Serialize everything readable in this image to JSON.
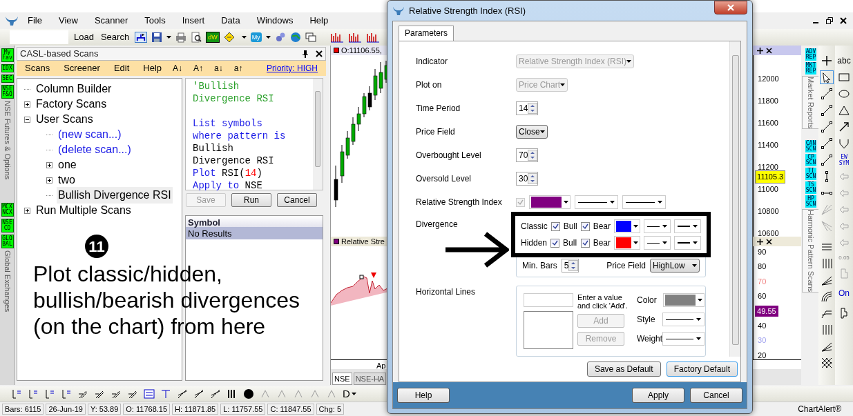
{
  "app": {
    "menu": [
      "File",
      "View",
      "Scanner",
      "Tools",
      "Insert",
      "Data",
      "Windows",
      "Help"
    ]
  },
  "toolbar": {
    "buttons": [
      "Load",
      "Search"
    ],
    "badges": [
      "dW",
      "My"
    ]
  },
  "exchange_strip": [
    {
      "badges": [
        "My Fav",
        "IDX",
        "SEC",
        "NSE F&O"
      ],
      "label": "NSE Futures & Options"
    },
    {
      "badges": [
        "MCX NCX",
        "NSE CD",
        "GLO BAL"
      ],
      "label": "Global Exchanges"
    }
  ],
  "scans_panel": {
    "title": "CASL-based Scans",
    "menu": [
      "Scans",
      "Screener",
      "Edit",
      "Help"
    ],
    "case_buttons": [
      "A↓",
      "A↑",
      "a↓",
      "a↑"
    ],
    "priority": "Priority: HIGH",
    "tree": [
      {
        "label": "Column Builder",
        "kind": "item",
        "selected": false
      },
      {
        "label": "Factory Scans",
        "kind": "folder",
        "expanded": false,
        "selected": false
      },
      {
        "label": "User Scans",
        "kind": "folder",
        "expanded": true,
        "selected": false,
        "children": [
          {
            "label": "(new scan...)",
            "kind": "action",
            "selected": false
          },
          {
            "label": "(delete scan...)",
            "kind": "action",
            "selected": false
          },
          {
            "label": "one",
            "kind": "folder",
            "expanded": false,
            "selected": false
          },
          {
            "label": "two",
            "kind": "folder",
            "expanded": false,
            "selected": false
          },
          {
            "label": "Bullish Divergence RSI",
            "kind": "item",
            "selected": true
          }
        ]
      },
      {
        "label": "Run Multiple Scans",
        "kind": "folder",
        "expanded": false,
        "selected": false
      }
    ],
    "code": [
      {
        "kind": "comment",
        "segments": [
          {
            "kind": "comment",
            "text": "'Bullish Divergence RSI"
          }
        ]
      },
      {
        "kind": "statement",
        "segments": [
          {
            "kind": "keyword",
            "text": "List symbols where pattern is"
          },
          {
            "kind": "plain",
            "text": " Bullish Divergence RSI"
          }
        ]
      },
      {
        "kind": "statement",
        "segments": [
          {
            "kind": "keyword",
            "text": "Plot"
          },
          {
            "kind": "plain",
            "text": " RSI("
          },
          {
            "kind": "number",
            "text": "14"
          },
          {
            "kind": "plain",
            "text": ")"
          }
        ]
      },
      {
        "kind": "statement",
        "segments": [
          {
            "kind": "keyword",
            "text": "Apply to"
          },
          {
            "kind": "plain",
            "text": " NSE"
          }
        ]
      }
    ],
    "buttons": [
      {
        "label": "Save",
        "disabled": true
      },
      {
        "label": "Run",
        "disabled": false
      },
      {
        "label": "Cancel",
        "disabled": false
      }
    ],
    "results": {
      "column": "Symbol",
      "rows": [
        {
          "label": "No Results",
          "selected": true
        }
      ]
    }
  },
  "annotation": {
    "number": "11",
    "text": "Plot classic/hidden, bullish/bearish divergences (on the chart) from here"
  },
  "chart": {
    "price_header": "O:11106.55,",
    "price_ticks": [
      "12000",
      "11800",
      "11600",
      "11400",
      "11200",
      "11000",
      "10800",
      "10600"
    ],
    "last_price": "11105.3",
    "indicator_header": "Relative Stre",
    "rsi_ticks": [
      {
        "label": "90",
        "kind": "grid"
      },
      {
        "label": "80",
        "kind": "grid"
      },
      {
        "label": "70",
        "kind": "overbought"
      },
      {
        "label": "60",
        "kind": "grid"
      },
      {
        "label": "49.55",
        "kind": "current"
      },
      {
        "label": "40",
        "kind": "grid"
      },
      {
        "label": "30",
        "kind": "oversold"
      },
      {
        "label": "20",
        "kind": "grid"
      }
    ],
    "x_label": "Ap",
    "tabs": [
      {
        "label": "NSE",
        "selected": true
      },
      {
        "label": "NSE-HA",
        "selected": false
      }
    ]
  },
  "side_tabs": [
    {
      "badges": [
        "ADV REP",
        "MKT REP"
      ],
      "label": "Market Reports"
    },
    {
      "badges": [
        "CAN SCN",
        "CP SCN",
        "TI SCN",
        "TS SCN",
        "HP SCN"
      ],
      "label": "Harmonic Pattern Scans"
    }
  ],
  "tool_labels": [
    "abc",
    "EW SYM",
    "0.05",
    "On"
  ],
  "bottom_toolbar": {
    "labels": [
      "D"
    ]
  },
  "status_bar": [
    "Bars: 6115",
    "26-Jun-19",
    "Y: 53.89",
    "O: 11768.15",
    "H: 11871.85",
    "L: 11757.55",
    "C: 11847.55",
    "Chg: 5"
  ],
  "brand": "ChartAlert®",
  "dialog": {
    "title": "Relative Strength Index (RSI)",
    "tabs": [
      {
        "label": "Parameters",
        "selected": true
      }
    ],
    "fields": [
      {
        "kind": "dropdown",
        "label": "Indicator",
        "value": "Relative Strength Index (RSI)",
        "disabled": true
      },
      {
        "kind": "dropdown",
        "label": "Plot on",
        "value": "Price Chart",
        "disabled": true
      },
      {
        "kind": "spinner",
        "label": "Time Period",
        "value": "14"
      },
      {
        "kind": "dropdown",
        "label": "Price Field",
        "value": "Close",
        "disabled": false
      },
      {
        "kind": "spinner",
        "label": "Overbought Level",
        "value": "70"
      },
      {
        "kind": "spinner",
        "label": "Oversold Level",
        "value": "30"
      },
      {
        "kind": "plot_style",
        "label": "Relative Strength Index",
        "checked": true,
        "disabled": true,
        "color": "#800080"
      }
    ],
    "divergence": {
      "label": "Divergence",
      "rows": [
        {
          "label": "Classic",
          "bull": {
            "label": "Bull",
            "checked": true
          },
          "bear": {
            "label": "Bear",
            "checked": true
          },
          "color": "#0000ff"
        },
        {
          "label": "Hidden",
          "bull": {
            "label": "Bull",
            "checked": true
          },
          "bear": {
            "label": "Bear",
            "checked": true
          },
          "color": "#ff0000"
        }
      ],
      "min_bars": {
        "label": "Min. Bars",
        "value": "5"
      },
      "price_field": {
        "label": "Price Field",
        "value": "HighLow"
      }
    },
    "horizontal_lines": {
      "label": "Horizontal Lines",
      "hint": "Enter a value and click 'Add'.",
      "buttons": [
        {
          "label": "Add",
          "disabled": true
        },
        {
          "label": "Remove",
          "disabled": true
        }
      ],
      "color_label": "Color",
      "color": "#808080",
      "style_label": "Style",
      "weight_label": "Weight"
    },
    "buttons": [
      {
        "label": "Save as Default",
        "focused": false
      },
      {
        "label": "Factory Default",
        "focused": true
      }
    ],
    "footer_buttons": [
      "Help",
      "Apply",
      "Cancel"
    ]
  }
}
